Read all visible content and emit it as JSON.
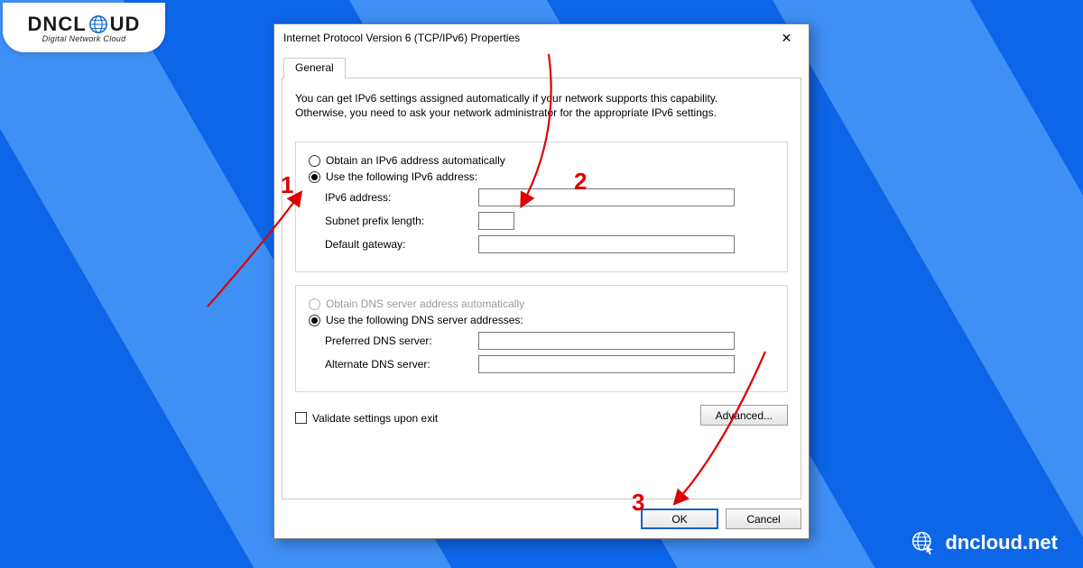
{
  "brand": {
    "name_prefix": "DNCL",
    "name_suffix": "UD",
    "tagline": "Digital Network Cloud",
    "footer_domain": "dncloud.net"
  },
  "dialog": {
    "title": "Internet Protocol Version 6 (TCP/IPv6) Properties",
    "tabs": {
      "general": "General"
    },
    "description": "You can get IPv6 settings assigned automatically if your network supports this capability. Otherwise, you need to ask your network administrator for the appropriate IPv6 settings.",
    "ip_group": {
      "auto_label": "Obtain an IPv6 address automatically",
      "manual_label": "Use the following IPv6 address:",
      "ipv6_label": "IPv6 address:",
      "ipv6_value": "",
      "prefix_label": "Subnet prefix length:",
      "prefix_value": "",
      "gateway_label": "Default gateway:",
      "gateway_value": ""
    },
    "dns_group": {
      "auto_label": "Obtain DNS server address automatically",
      "manual_label": "Use the following DNS server addresses:",
      "preferred_label": "Preferred DNS server:",
      "preferred_value": "",
      "alternate_label": "Alternate DNS server:",
      "alternate_value": ""
    },
    "validate_label": "Validate settings upon exit",
    "advanced_label": "Advanced...",
    "ok_label": "OK",
    "cancel_label": "Cancel"
  },
  "annotations": {
    "n1": "1",
    "n2": "2",
    "n3": "3"
  },
  "colors": {
    "accent": "#0b61c4",
    "annotation": "#dd0000",
    "bg_primary": "#0d66e8",
    "bg_stripe": "#3f90f5"
  }
}
